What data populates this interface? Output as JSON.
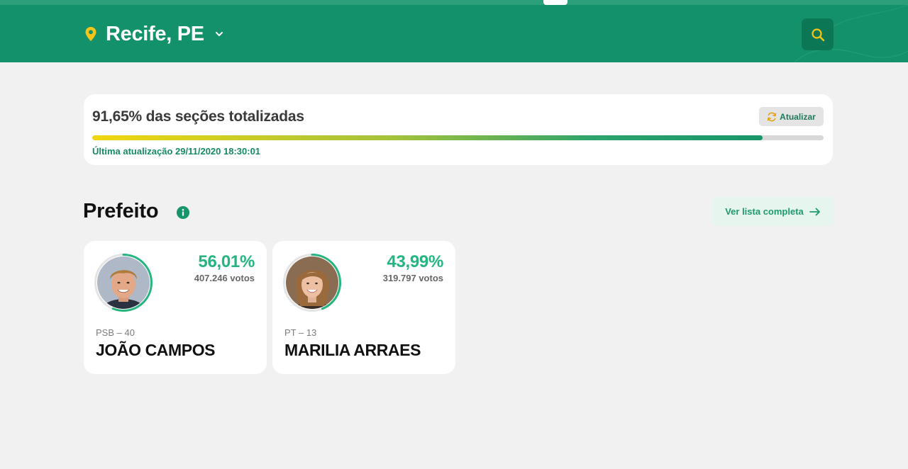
{
  "header": {
    "location": "Recife, PE",
    "colors": {
      "background": "#12916a",
      "pin": "#f5c518",
      "search_bg": "#0c7754",
      "search_icon": "#f5c518"
    },
    "icons": [
      "map-pin-icon",
      "chevron-down-icon",
      "search-icon"
    ]
  },
  "status": {
    "title": "91,65% das seções totalizadas",
    "progress_fraction": 0.9165,
    "refresh_label": "Atualizar",
    "last_update": "Última atualização 29/11/2020 18:30:01"
  },
  "section": {
    "title": "Prefeito",
    "full_list_label": "Ver lista completa",
    "icons": [
      "info-icon",
      "arrow-right-icon"
    ]
  },
  "candidates": [
    {
      "percent": "56,01%",
      "percent_fraction": 0.5601,
      "votes": "407.246 votos",
      "party": "PSB – 40",
      "name": "JOÃO CAMPOS"
    },
    {
      "percent": "43,99%",
      "percent_fraction": 0.4399,
      "votes": "319.797 votos",
      "party": "PT – 13",
      "name": "MARILIA ARRAES"
    }
  ]
}
